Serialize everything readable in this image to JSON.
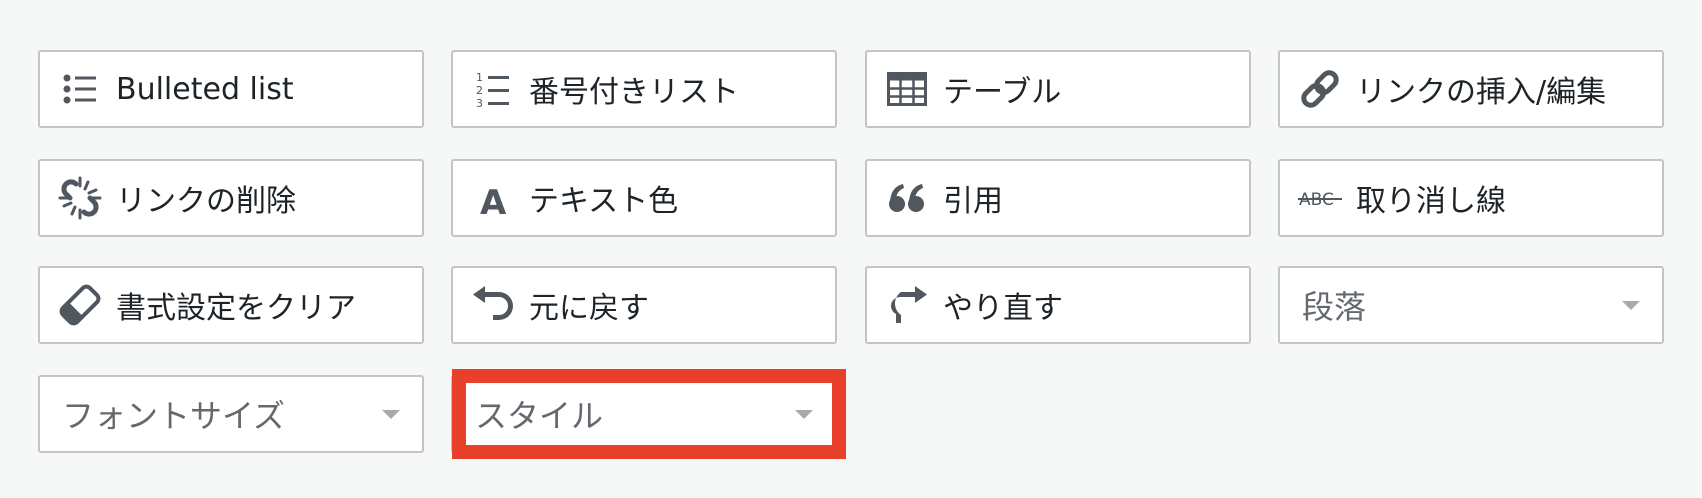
{
  "buttons": {
    "bulleted_list": "Bulleted list",
    "numbered_list": "番号付きリスト",
    "table": "テーブル",
    "insert_link": "リンクの挿入/編集",
    "remove_link": "リンクの削除",
    "text_color": "テキスト色",
    "blockquote": "引用",
    "strikethrough": "取り消し線",
    "clear_formatting": "書式設定をクリア",
    "undo": "元に戻す",
    "redo": "やり直す"
  },
  "selects": {
    "format": "段落",
    "font_size": "フォントサイズ",
    "styles": "スタイル"
  },
  "icons": {
    "bulleted_list": "bulleted-list-icon",
    "numbered_list": "numbered-list-icon",
    "table": "table-icon",
    "insert_link": "link-icon",
    "remove_link": "unlink-icon",
    "text_color": "text-color-icon",
    "blockquote": "quote-icon",
    "strikethrough": "strikethrough-icon",
    "clear_formatting": "eraser-icon",
    "undo": "undo-icon",
    "redo": "redo-icon"
  },
  "numbered_list_icon_digits": [
    "1",
    "2",
    "3"
  ],
  "strikethrough_icon_text": "ABC",
  "text_color_icon_text": "A",
  "colors": {
    "highlight": "#e8402a",
    "icon": "#50575e",
    "background": "#f6f7f7",
    "border": "#c3c4c7"
  }
}
